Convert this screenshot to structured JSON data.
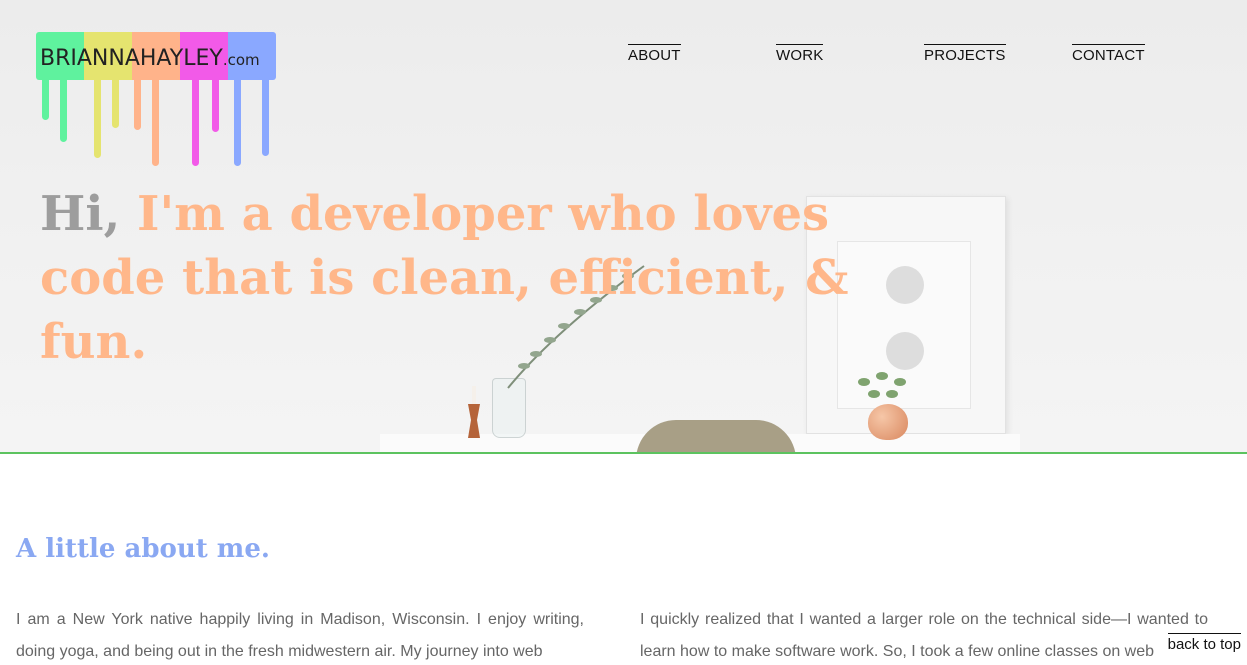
{
  "logo": {
    "text_main": "BRIANNAHAYLEY",
    "text_suffix": ".com",
    "colors": [
      "#5ff29e",
      "#e5e46f",
      "#ffb38a",
      "#f25ae8",
      "#8aa8ff"
    ]
  },
  "nav": {
    "items": [
      {
        "label": "ABOUT"
      },
      {
        "label": "WORK"
      },
      {
        "label": "PROJECTS"
      },
      {
        "label": "CONTACT"
      }
    ]
  },
  "hero": {
    "headline_hi": "Hi,",
    "headline_rest": "I'm a developer who loves code that is clean, efficient, & fun.",
    "accent_color": "#ffb78a",
    "border_color": "#5cc35f"
  },
  "about": {
    "title": "A little about me.",
    "col1": "I am a New York native happily living in Madison, Wisconsin. I enjoy writing, doing yoga, and being out in the fresh midwestern air. My journey into web",
    "col2": "I quickly realized that I wanted a larger role on the technical side—I wanted to learn how to make software work. So, I took a few online classes on web"
  },
  "back_to_top": "back to top"
}
